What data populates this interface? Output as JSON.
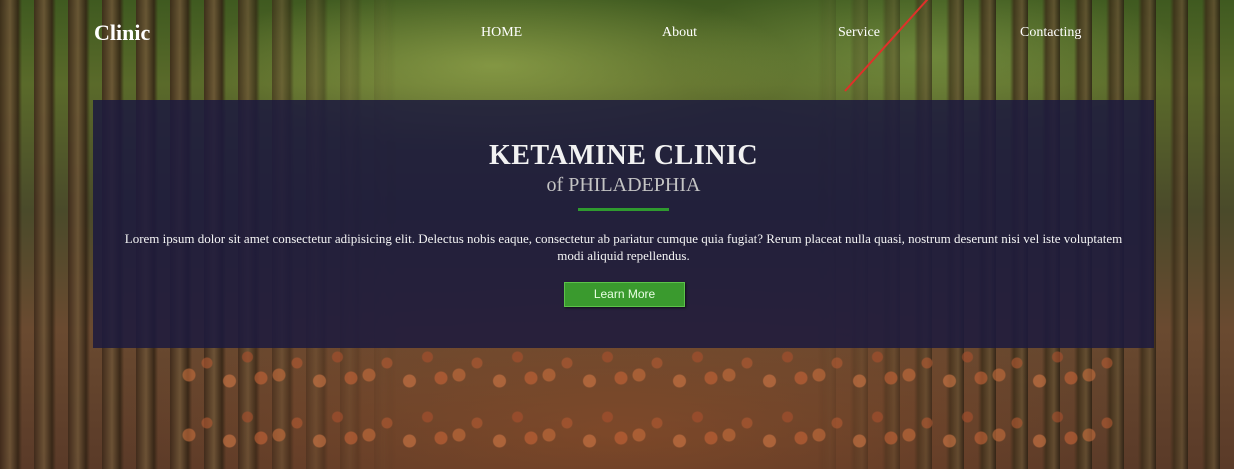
{
  "nav": {
    "brand": "Clinic",
    "links": [
      "HOME",
      "About",
      "Service",
      "Contacting"
    ]
  },
  "hero": {
    "title": "KETAMINE CLINIC",
    "subtitle": "of PHILADEPHIA",
    "text": "Lorem ipsum dolor sit amet consectetur adipisicing elit. Delectus nobis eaque, consectetur ab pariatur cumque quia fugiat? Rerum placeat nulla quasi, nostrum deserunt nisi vel iste voluptatem modi aliquid repellendus.",
    "button_label": "Learn More"
  },
  "colors": {
    "overlay": "#1c1a3e",
    "accent": "#3a9a2e",
    "divider": "#2f9a2f",
    "annotation_line": "#e0302a"
  },
  "background": {
    "image": "forest-boardwalk-autumn-leaves"
  }
}
